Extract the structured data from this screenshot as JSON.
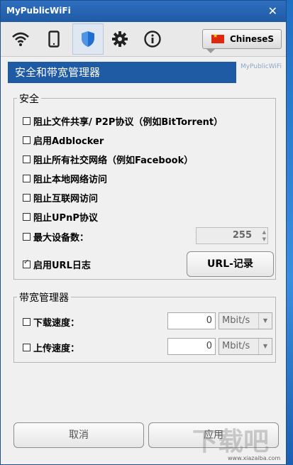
{
  "window": {
    "title": "MyPublicWiFi",
    "close_glyph": "✕"
  },
  "toolbar": {
    "buttons": [
      {
        "icon": "wifi-icon"
      },
      {
        "icon": "phone-icon"
      },
      {
        "icon": "shield-icon",
        "active": true
      },
      {
        "icon": "gear-icon"
      },
      {
        "icon": "info-icon"
      }
    ],
    "language": "ChineseS"
  },
  "header": {
    "title": "安全和带宽管理器",
    "brand": "MyPublicWiFi"
  },
  "security": {
    "legend": "安全",
    "block_file_sharing": "阻止文件共享/ P2P协议（例如BitTorrent）",
    "enable_adblocker": "启用Adblocker",
    "block_social": "阻止所有社交网络（例如Facebook）",
    "block_local": "阻止本地网络访问",
    "block_internet": "阻止互联网访问",
    "block_upnp": "阻止UPnP协议",
    "max_devices": "最大设备数：",
    "max_devices_value": "255",
    "enable_url_log": "启用URL日志",
    "url_log_checked": true,
    "url_record_button": "URL-记录"
  },
  "bandwidth": {
    "legend": "带宽管理器",
    "download_label": "下载速度：",
    "download_value": "0",
    "download_unit": "Mbit/s",
    "upload_label": "上传速度：",
    "upload_value": "0",
    "upload_unit": "Mbit/s"
  },
  "footer": {
    "cancel": "取消",
    "apply": "应用"
  },
  "watermark": {
    "text": "下载吧",
    "sub": "www.xiazaiba.com"
  },
  "colors": {
    "accent": "#1f5aa5",
    "titlebar": "#2f6fbf"
  }
}
